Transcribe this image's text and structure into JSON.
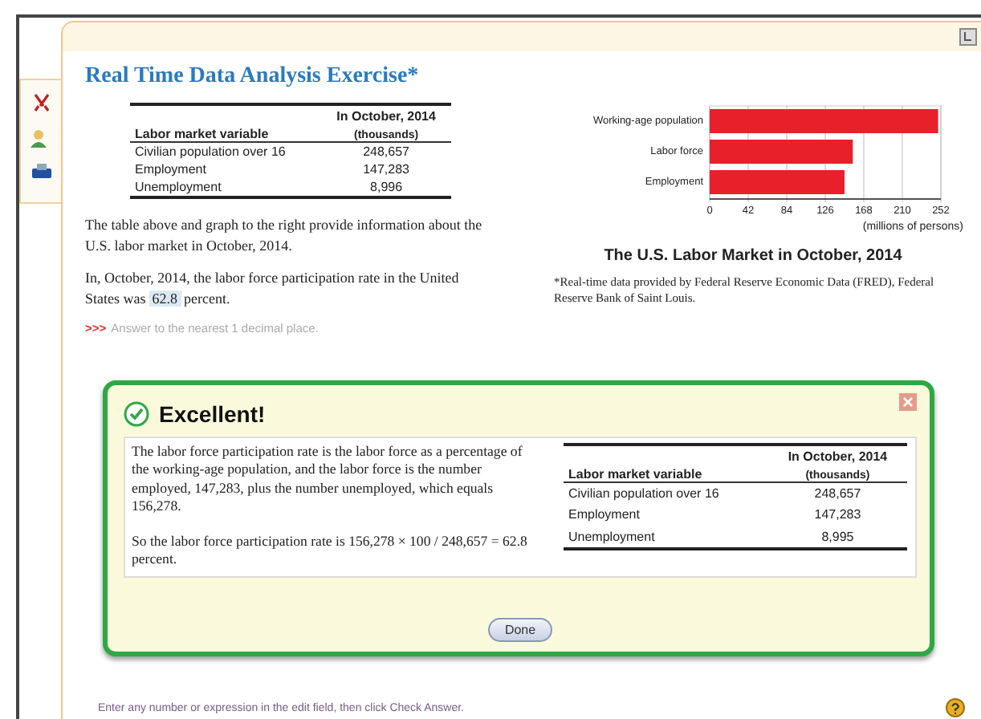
{
  "title": "Real Time Data Analysis Exercise*",
  "table": {
    "columns": [
      "Labor market variable",
      "In October, 2014",
      "(thousands)"
    ],
    "rows": [
      [
        "Civilian population over 16",
        "248,657"
      ],
      [
        "Employment",
        "147,283"
      ],
      [
        "Unemployment",
        "8,996"
      ]
    ]
  },
  "intro": "The table above and graph to the right provide information about the U.S. labor market in October, 2014.",
  "question": {
    "before": "In, October, 2014, the labor force participation rate in the United States was",
    "answer": "62.8",
    "after": "percent."
  },
  "hint": {
    "marker": ">>>",
    "text": "Answer to the nearest 1 decimal place."
  },
  "chart": {
    "chart_data": {
      "type": "bar",
      "orientation": "horizontal",
      "title": "The U.S. Labor Market in October, 2014",
      "xlabel": "(millions of persons)",
      "categories": [
        "Working-age population",
        "Labor force",
        "Employment"
      ],
      "values": [
        249,
        156,
        147
      ],
      "grid": true,
      "xlim": [
        0,
        252
      ],
      "xticks": [
        0,
        42,
        84,
        126,
        168,
        210,
        252
      ]
    },
    "note": "*Real-time data provided by Federal Reserve Economic Data (FRED), Federal Reserve Bank of Saint Louis."
  },
  "feedback": {
    "heading": "Excellent!",
    "explanation": "The labor force participation rate is the labor force as a percentage of the working-age population, and the labor force is the number employed, 147,283, plus the number unemployed, which equals 156,278.",
    "result": "So the labor force participation rate is 156,278 × 100 / 248,657 = 62.8 percent.",
    "table": {
      "columns": [
        "Labor market variable",
        "In October, 2014",
        "(thousands)"
      ],
      "rows": [
        [
          "Civilian population over 16",
          "248,657"
        ],
        [
          "Employment",
          "147,283"
        ],
        [
          "Unemployment",
          "8,995"
        ]
      ]
    },
    "button": "Done"
  },
  "status_bar": "Enter any number or expression in the edit field, then click Check Answer."
}
